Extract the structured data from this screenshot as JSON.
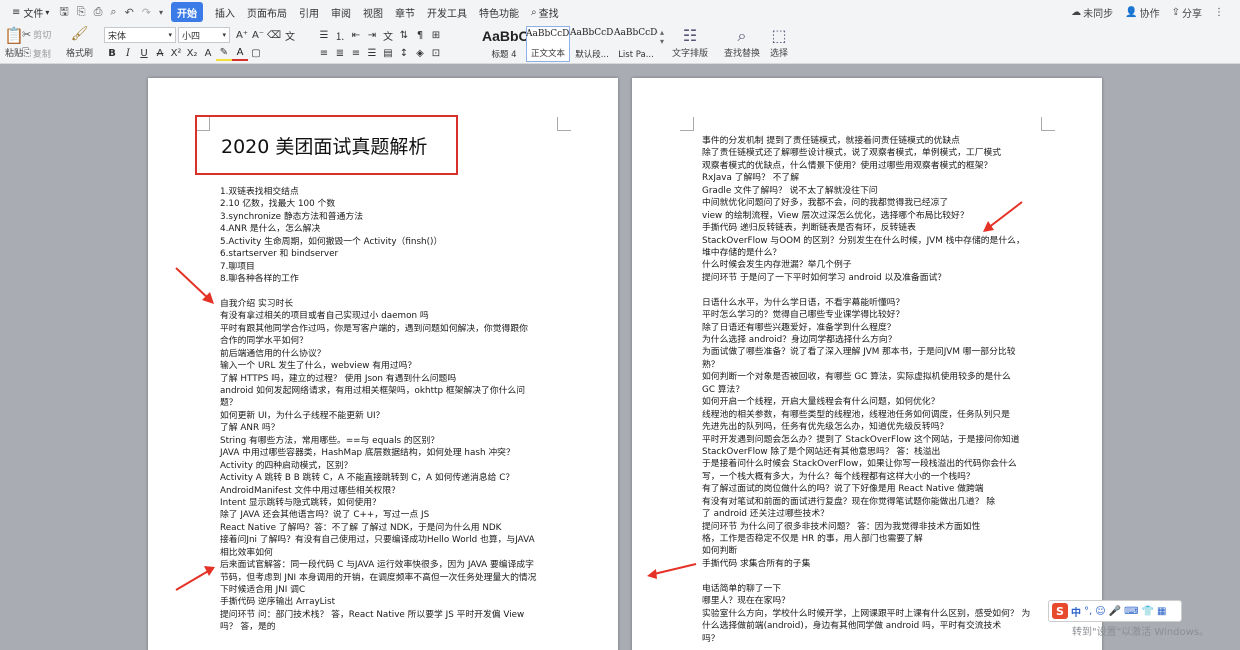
{
  "menubar": {
    "file": "文件",
    "start": "开始",
    "tabs": [
      "插入",
      "页面布局",
      "引用",
      "审阅",
      "视图",
      "章节",
      "开发工具",
      "特色功能"
    ],
    "search": "查找",
    "unsync": "未同步",
    "collab": "协作",
    "share": "分享"
  },
  "toolbar": {
    "paste": "粘贴",
    "cut": "剪切",
    "copy": "复制",
    "format_painter": "格式刷",
    "font_name": "宋体",
    "font_size": "小四",
    "styles": [
      {
        "preview": "AaBbC",
        "caption": "标题 4"
      },
      {
        "preview": "AaBbCcDd",
        "caption": "正文文本"
      },
      {
        "preview": "AaBbCcDd",
        "caption": "默认段..."
      },
      {
        "preview": "AaBbCcDd",
        "caption": "List Pa..."
      }
    ],
    "text_layout": "文字排版",
    "find_replace": "查找替换",
    "select": "选择"
  },
  "left_page": {
    "title": "2020 美团面试真题解析",
    "lines": [
      "1.双链表找相交结点",
      "2.10 亿数，找最大 100 个数",
      "3.synchronize 静态方法和普通方法",
      "4.ANR 是什么，怎么解决",
      "5.Activity 生命周期，如何撤毁一个 Activity（finsh()）",
      "6.startserver 和 bindserver",
      "7.聊项目",
      "8.聊各种各样的工作",
      "",
      "自我介绍 实习时长",
      "有没有拿过相关的项目或者自己实现过小 daemon 吗",
      "平时有跟其他同学合作过吗，你是写客户端的，遇到问题如何解决，你觉得跟你",
      "合作的同学水平如何？",
      "前后端通信用的什么协议？",
      "输入一个 URL 发生了什么，webview 有用过吗？",
      "了解 HTTPS 吗，建立的过程？ 使用 Json 有遇到什么问题吗",
      "android 如何发起网络请求，有用过相关框架吗，okhttp 框架解决了你什么问",
      "题？",
      "如何更新 UI，为什么子线程不能更新 UI？",
      "了解 ANR 吗？",
      "String 有哪些方法，常用哪些。==与 equals 的区别？",
      "JAVA 中用过哪些容器类，HashMap 底层数据结构，如何处理 hash 冲突？",
      "Activity 的四种启动模式，区别？",
      "Activity A 跳转 B B 跳转 C，A 不能直接跳转到 C，A 如何传递消息给 C？",
      "AndroidManifest 文件中用过哪些相关权限？",
      "Intent 显示跳转与隐式跳转，如何使用？",
      "除了 JAVA 还会其他语言吗？说了 C++，写过一点 JS",
      "React Native 了解吗？答：不了解 了解过 NDK，于是问为什么用 NDK",
      "接着问Jni 了解吗？有没有自己使用过，只要编译成功Hello World 也算，与JAVA",
      "相比效率如何",
      "后来面试官解答：同一段代码 C 与JAVA 运行效率快很多，因为 JAVA 要编译成字",
      "节码，但考虑到 JNI 本身调用的开销，在调度频率不高但一次任务处理量大的情况",
      "下时候适合用 JNI 调C",
      "手撕代码 逆序输出 ArrayList",
      "提问环节   问：部门技术栈？ 答，React Native 所以要学 JS 平时开发偏 View",
      "吗？ 答，是的"
    ]
  },
  "right_page": {
    "lines": [
      "事件的分发机制 提到了责任链模式，就接着问责任链模式的优缺点",
      "除了责任链模式还了解哪些设计模式，说了观察者模式，单例模式，工厂模式",
      "观察者模式的优缺点，什么情景下使用？使用过哪些用观察者模式的框架？",
      "RxJava 了解吗？ 不了解",
      "Gradle 文件了解吗？ 说不太了解就没往下问",
      "中间就优化问题问了好多，我都不会，问的我都觉得我已经凉了",
      "view 的绘制流程，View 层次过深怎么优化，选择哪个布局比较好？",
      "手撕代码    递归反转链表，判断链表是否有环，反转链表",
      "StackOverFlow 与OOM 的区别？分别发生在什么时候，JVM 栈中存储的是什么，",
      "堆中存储的是什么？",
      "什么时候会发生内存泄漏？举几个例子",
      "提问环节 于是问了一下平时如何学习 android 以及准备面试？",
      "",
      "日语什么水平，为什么学日语，不看字幕能听懂吗？",
      "平时怎么学习的？觉得自己哪些专业课学得比较好？",
      "除了日语还有哪些兴趣爱好，准备学到什么程度？",
      "为什么选择 android？身边同学都选择什么方向？",
      "为面试做了哪些准备？说了看了深入理解 JVM 那本书，于是问JVM 哪一部分比较",
      "熟？",
      "如何判断一个对象是否被回收，有哪些 GC 算法，实际虚拟机使用较多的是什么",
      "GC 算法？",
      "如何开启一个线程，开启大量线程会有什么问题，如何优化？",
      "线程池的相关参数，有哪些类型的线程池，线程池任务如何调度，任务队列只是",
      "先进先出的队列吗，任务有优先级怎么办，知道优先级反转吗？",
      "平时开发遇到问题会怎么办？提到了 StackOverFlow 这个网站，于是接问你知道",
      "StackOverFlow 除了是个网站还有其他意思吗？ 答：栈溢出",
      "于是接着问什么时候会 StackOverFlow，如果让你写一段栈溢出的代码你会什么",
      "写，一个栈大概有多大，为什么？每个线程都有这样大小的一个栈吗？",
      "有了解过面试的岗位做什么的吗？说了下好像是用 React Native 做跨端",
      "有没有对笔试和前面的面试进行复盘？现在你觉得笔试题你能做出几道？ 除",
      "了 android 还关注过哪些技术？",
      "提问环节    为什么问了很多非技术问题？  答：因为我觉得非技术方面如性",
      "格，工作是否稳定不仅是 HR 的事，用人部门也需要了解",
      "如何判断",
      "手撕代码    求集合所有的子集",
      "",
      "电话简单的聊了一下",
      "哪里人？现在在家吗？",
      "实验室什么方向，学校什么时候开学，上网课跟平时上课有什么区别，感受如何？ 为",
      "什么选择做前端(android)，身边有其他同学做 android 吗，平时有交流技术",
      "吗？"
    ]
  },
  "overlay": {
    "ime_logo": "S",
    "ime_text": "中",
    "watermark": "转到\"设置\"以激活 Windows。"
  },
  "colors": {
    "ribbon_bg": "#f3f4f6",
    "start_tab": "#3b7be8",
    "title_border": "#d8312b",
    "arrow_red": "#e53227",
    "workspace": "#a9adb3"
  }
}
